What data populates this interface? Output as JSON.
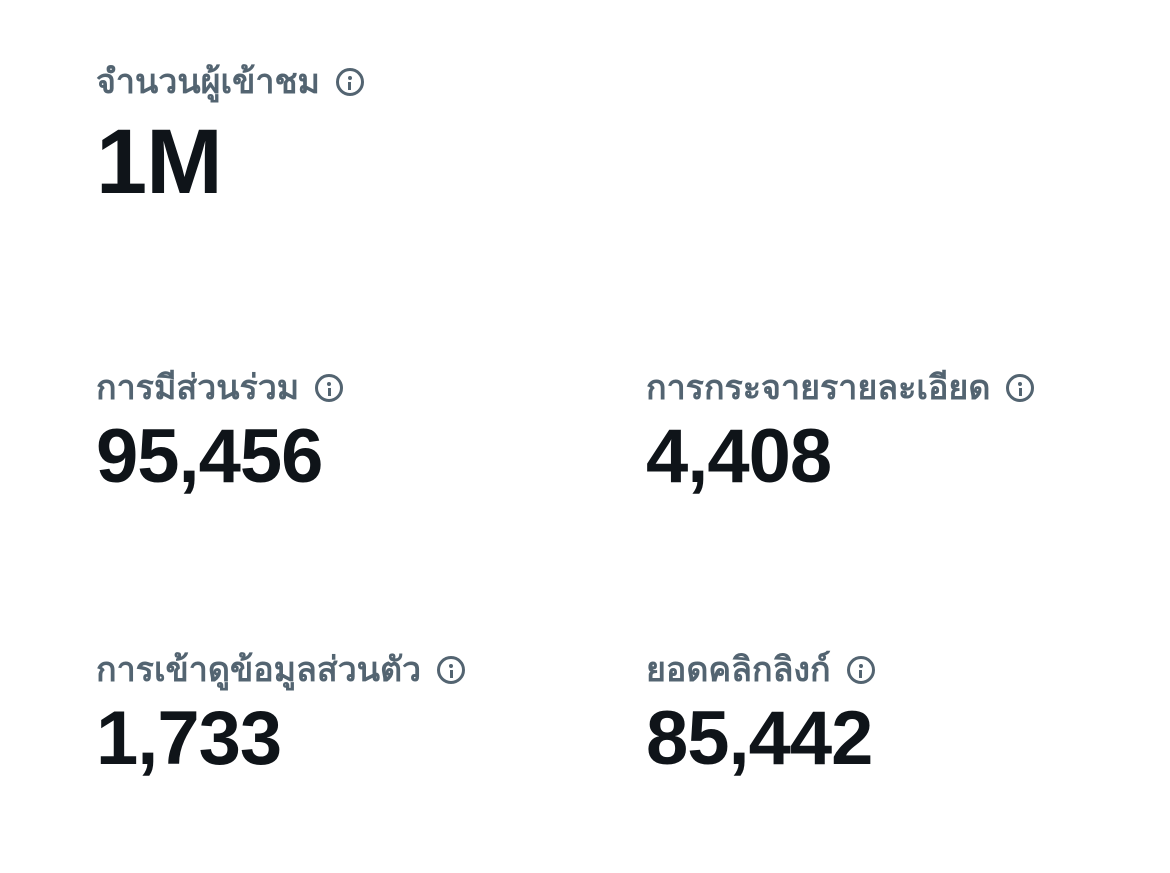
{
  "stats": [
    {
      "id": "impressions",
      "label": "จำนวนผู้เข้าชม",
      "value": "1M"
    },
    {
      "id": "engagements",
      "label": "การมีส่วนร่วม",
      "value": "95,456"
    },
    {
      "id": "detail_expands",
      "label": "การกระจายรายละเอียด",
      "value": "4,408"
    },
    {
      "id": "profile_visits",
      "label": "การเข้าดูข้อมูลส่วนตัว",
      "value": "1,733"
    },
    {
      "id": "link_clicks",
      "label": "ยอดคลิกลิงก์",
      "value": "85,442"
    }
  ],
  "icons": {
    "info": "info-circle-icon"
  },
  "colors": {
    "label": "#536471",
    "value": "#0f1419",
    "background": "#ffffff"
  }
}
